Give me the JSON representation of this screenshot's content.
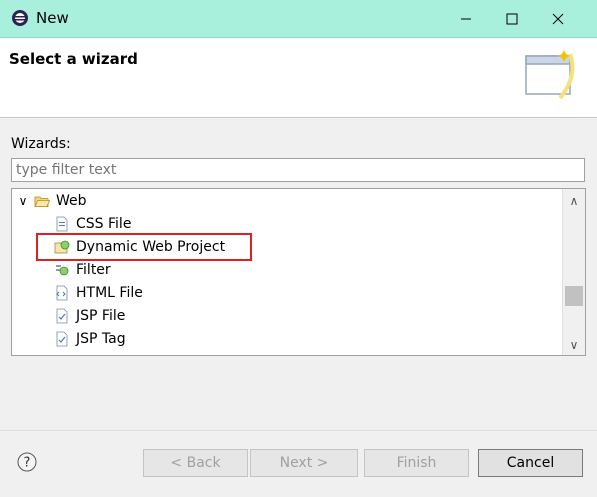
{
  "window": {
    "title": "New"
  },
  "header": {
    "title": "Select a wizard"
  },
  "wizards_label": "Wizards:",
  "filter": {
    "placeholder": "type filter text",
    "value": ""
  },
  "tree": {
    "folder": {
      "label": "Web",
      "expanded": true
    },
    "items": [
      {
        "label": "CSS File",
        "icon": "css-file-icon"
      },
      {
        "label": "Dynamic Web Project",
        "icon": "dynamic-web-project-icon",
        "highlighted": true
      },
      {
        "label": "Filter",
        "icon": "filter-icon"
      },
      {
        "label": "HTML File",
        "icon": "html-file-icon"
      },
      {
        "label": "JSP File",
        "icon": "jsp-file-icon"
      },
      {
        "label": "JSP Tag",
        "icon": "jsp-tag-icon"
      }
    ]
  },
  "buttons": {
    "back": "< Back",
    "next": "Next >",
    "finish": "Finish",
    "cancel": "Cancel"
  },
  "colors": {
    "titlebar": "#a8f0dc",
    "highlight_box": "#e02020"
  }
}
